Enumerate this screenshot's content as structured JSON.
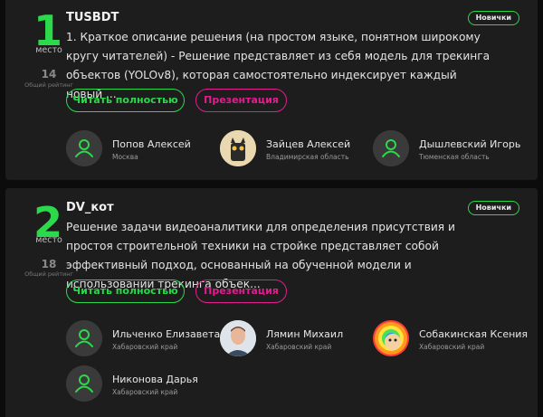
{
  "cards": [
    {
      "place": "1",
      "place_label": "место",
      "rating": "14",
      "rating_label": "Общий рейтинг",
      "team": "TUSBDT",
      "badge": "Новички",
      "description": "1. Краткое описание решения (на простом языке, понятном широкому кругу читателей) - Решение представляет из себя модель для трекинга объектов (YOLOv8), которая самостоятельно индексирует каждый новый ...",
      "read_label": "Читать полностью",
      "presentation_label": "Презентация",
      "members": [
        {
          "name": "Попов Алексей",
          "region": "Москва",
          "avatar": "user-placeholder-icon"
        },
        {
          "name": "Зайцев Алексей",
          "region": "Владимирская область",
          "avatar": "cartoon-character-avatar"
        },
        {
          "name": "Дышлевский Игорь",
          "region": "Тюменская область",
          "avatar": "user-placeholder-icon"
        }
      ]
    },
    {
      "place": "2",
      "place_label": "место",
      "rating": "18",
      "rating_label": "Общий рейтинг",
      "team": "DV_кот",
      "badge": "Новички",
      "description": "Решение задачи видеоаналитики для определения присутствия и простоя строительной техники на стройке представляет собой эффективный подход, основанный на обученной модели и использовании трекинга объек...",
      "read_label": "Читать полностью",
      "presentation_label": "Презентация",
      "members": [
        {
          "name": "Ильченко Елизавета",
          "region": "Хабаровский край",
          "avatar": "user-placeholder-icon"
        },
        {
          "name": "Лямин Михаил",
          "region": "Хабаровский край",
          "avatar": "person-photo-avatar"
        },
        {
          "name": "Собакинская Ксения",
          "region": "Хабаровский край",
          "avatar": "rainbow-meme-avatar"
        },
        {
          "name": "Никонова Дарья",
          "region": "Хабаровский край",
          "avatar": "user-placeholder-icon"
        }
      ]
    }
  ],
  "colors": {
    "accent_green": "#2bd94a",
    "accent_pink": "#e21d8d",
    "card_bg": "#1d1d1d",
    "page_bg": "#0c0c0c"
  }
}
